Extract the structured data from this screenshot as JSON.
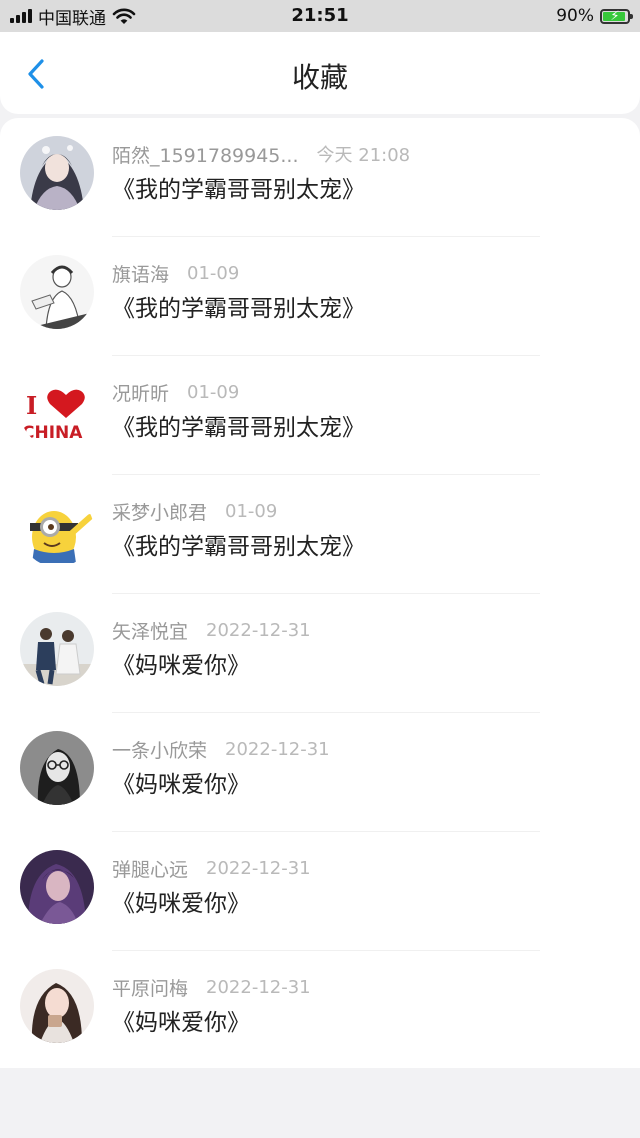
{
  "status_bar": {
    "carrier": "中国联通",
    "time": "21:51",
    "battery_percent": "90%",
    "battery_level": 0.9,
    "icons": [
      "signal-icon",
      "wifi-icon",
      "battery-charging-icon"
    ]
  },
  "nav": {
    "back_icon": "chevron-left-icon",
    "title": "收藏",
    "accent": "#1e90e8"
  },
  "favorites": [
    {
      "user": "陌然_1591789945...",
      "date": "今天 21:08",
      "title": "《我的学霸哥哥别太宠》"
    },
    {
      "user": "旗语海",
      "date": "01-09",
      "title": "《我的学霸哥哥别太宠》"
    },
    {
      "user": "况昕昕",
      "date": "01-09",
      "title": "《我的学霸哥哥别太宠》",
      "avatar_text": [
        "I",
        "CHINA"
      ]
    },
    {
      "user": "采梦小郎君",
      "date": "01-09",
      "title": "《我的学霸哥哥别太宠》"
    },
    {
      "user": "矢泽悦宜",
      "date": "2022-12-31",
      "title": "《妈咪爱你》"
    },
    {
      "user": "一条小欣荣",
      "date": "2022-12-31",
      "title": "《妈咪爱你》"
    },
    {
      "user": "弹腿心远",
      "date": "2022-12-31",
      "title": "《妈咪爱你》"
    },
    {
      "user": "平原问梅",
      "date": "2022-12-31",
      "title": "《妈咪爱你》"
    }
  ]
}
